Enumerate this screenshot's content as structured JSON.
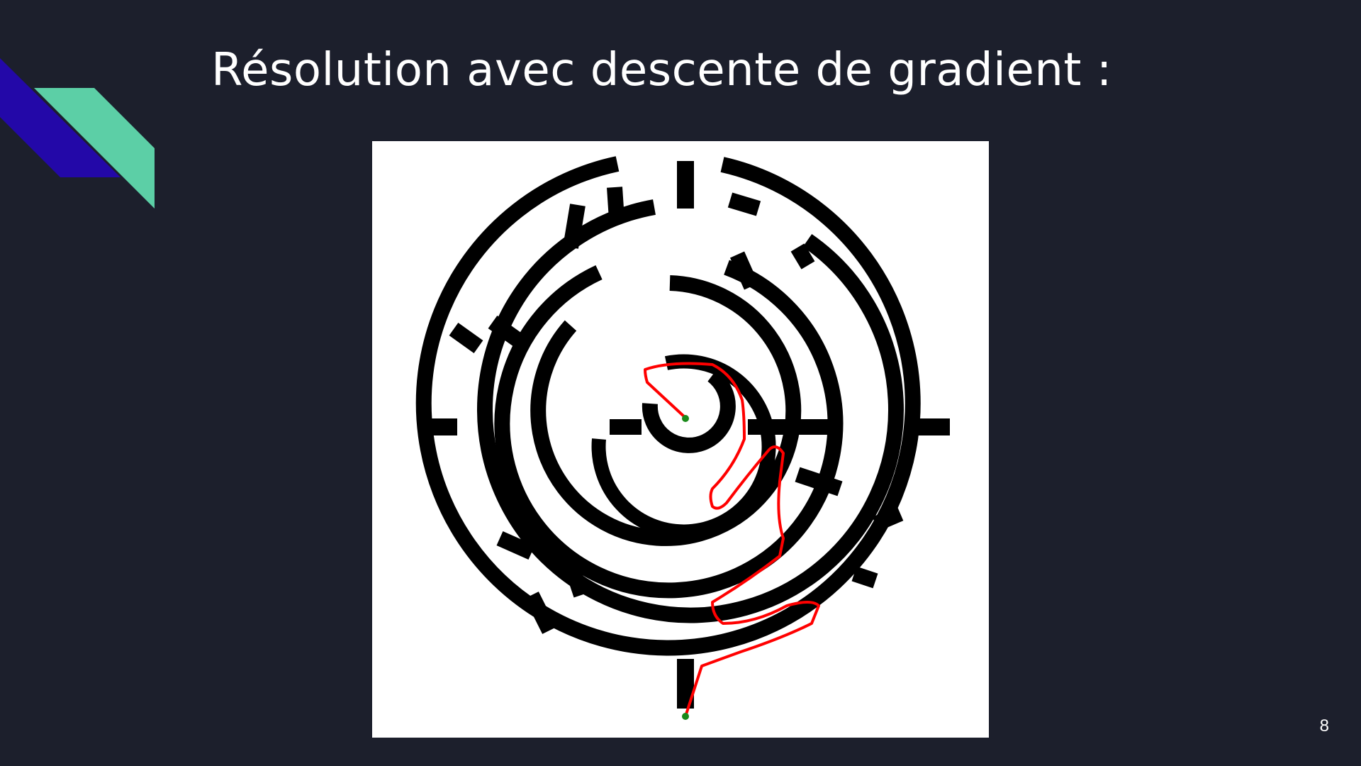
{
  "slide": {
    "title": "Résolution avec descente de gradient :",
    "page_number": "8"
  },
  "colors": {
    "background": "#1c1f2c",
    "accent_blue": "#2308a8",
    "accent_green": "#5ccfa6",
    "maze_wall": "#000000",
    "maze_background": "#ffffff",
    "path": "#ff0000",
    "endpoints": "#1a8a1a"
  }
}
